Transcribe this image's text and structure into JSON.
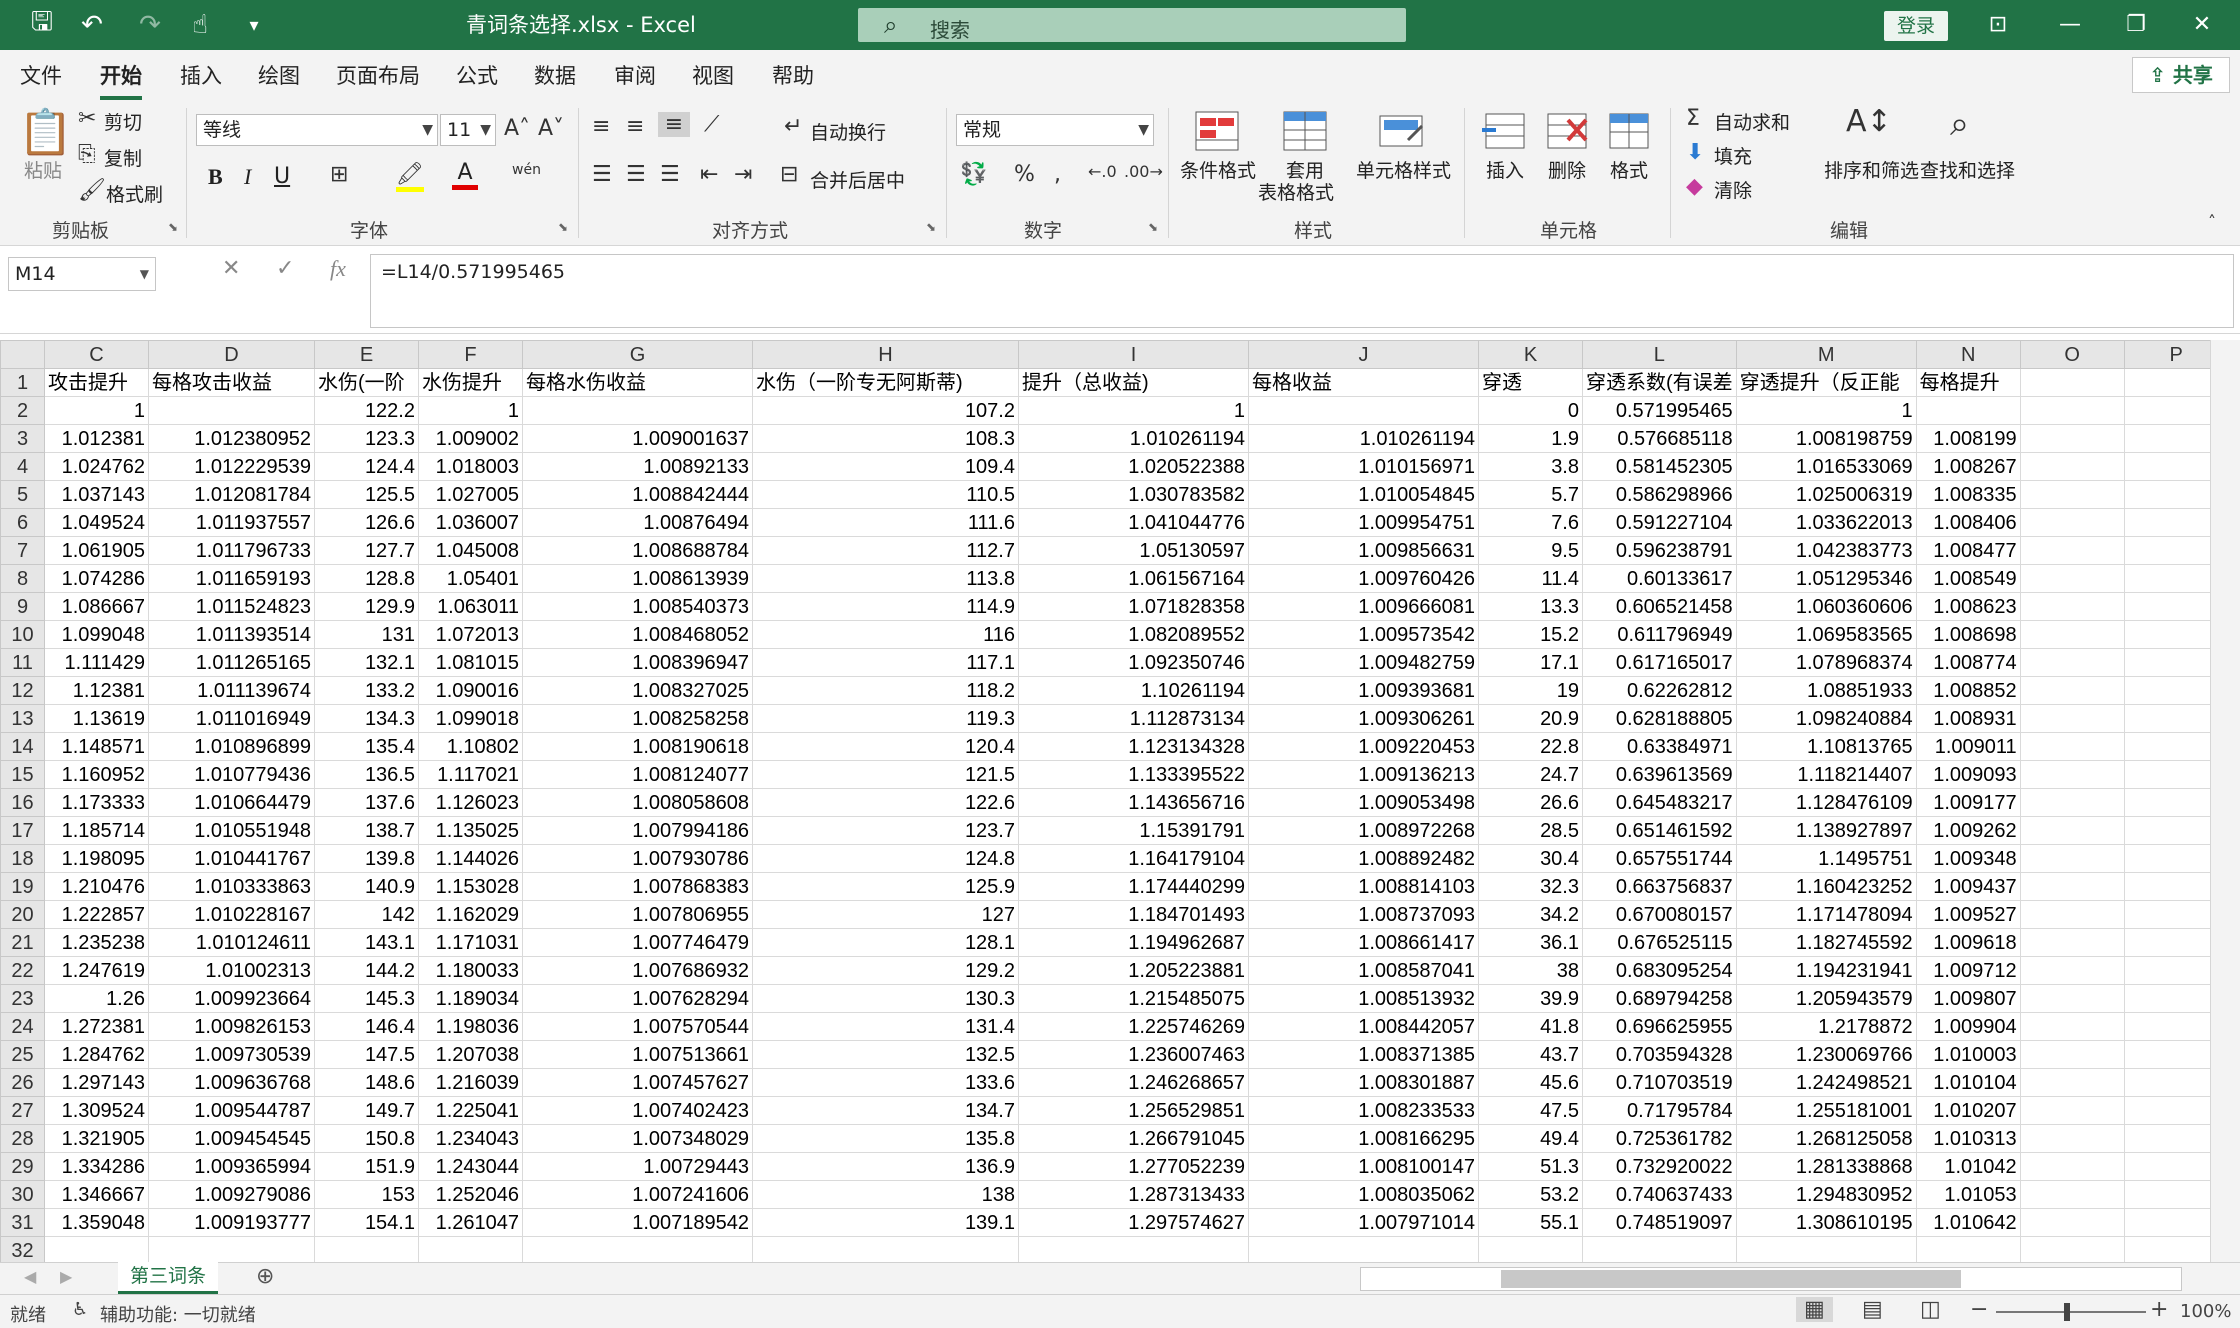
{
  "window": {
    "doc_title": "青词条选择.xlsx  -  Excel",
    "search_placeholder": "搜索",
    "login_label": "登录"
  },
  "menu": {
    "tabs": [
      "文件",
      "开始",
      "插入",
      "绘图",
      "页面布局",
      "公式",
      "数据",
      "审阅",
      "视图",
      "帮助"
    ],
    "active_tab": "开始",
    "share_label": "共享"
  },
  "ribbon": {
    "clipboard": {
      "label": "剪贴板",
      "paste": "粘贴",
      "cut": "剪切",
      "copy": "复制",
      "format_painter": "格式刷"
    },
    "font": {
      "label": "字体",
      "font_name": "等线",
      "font_size": "11",
      "bold": "B",
      "italic": "I",
      "underline": "U"
    },
    "alignment": {
      "label": "对齐方式",
      "wrap_text": "自动换行",
      "merge_center": "合并后居中"
    },
    "number": {
      "label": "数字",
      "format": "常规"
    },
    "styles": {
      "label": "样式",
      "conditional": "条件格式",
      "table_fmt_1": "套用",
      "table_fmt_2": "表格格式",
      "cell_styles": "单元格样式"
    },
    "cells": {
      "label": "单元格",
      "insert": "插入",
      "delete": "删除",
      "format": "格式"
    },
    "editing": {
      "label": "编辑",
      "autosum": "自动求和",
      "fill": "填充",
      "clear": "清除",
      "sort_filter": "排序和筛选",
      "find_select": "查找和选择"
    }
  },
  "formula_bar": {
    "name_box": "M14",
    "formula": "=L14/0.571995465",
    "fx": "fx"
  },
  "sheet": {
    "selected_column": "",
    "columns": [
      "C",
      "D",
      "E",
      "F",
      "G",
      "H",
      "I",
      "J",
      "K",
      "L",
      "M",
      "N",
      "O",
      "P"
    ],
    "header_row": [
      "攻击提升",
      "每格攻击收益",
      "水伤(一阶",
      "水伤提升",
      "每格水伤收益",
      "水伤（一阶专无阿斯蒂)",
      "提升（总收益)",
      "每格收益",
      "穿透",
      "穿透系数(有误差",
      "穿透提升（反正能",
      "每格提升",
      "",
      ""
    ],
    "rows": [
      [
        "1",
        "",
        "122.2",
        "1",
        "",
        "107.2",
        "1",
        "",
        "0",
        "0.571995465",
        "1",
        "",
        "",
        ""
      ],
      [
        "1.012381",
        "1.012380952",
        "123.3",
        "1.009002",
        "1.009001637",
        "108.3",
        "1.010261194",
        "1.010261194",
        "1.9",
        "0.576685118",
        "1.008198759",
        "1.008199",
        "",
        ""
      ],
      [
        "1.024762",
        "1.012229539",
        "124.4",
        "1.018003",
        "1.00892133",
        "109.4",
        "1.020522388",
        "1.010156971",
        "3.8",
        "0.581452305",
        "1.016533069",
        "1.008267",
        "",
        ""
      ],
      [
        "1.037143",
        "1.012081784",
        "125.5",
        "1.027005",
        "1.008842444",
        "110.5",
        "1.030783582",
        "1.010054845",
        "5.7",
        "0.586298966",
        "1.025006319",
        "1.008335",
        "",
        ""
      ],
      [
        "1.049524",
        "1.011937557",
        "126.6",
        "1.036007",
        "1.00876494",
        "111.6",
        "1.041044776",
        "1.009954751",
        "7.6",
        "0.591227104",
        "1.033622013",
        "1.008406",
        "",
        ""
      ],
      [
        "1.061905",
        "1.011796733",
        "127.7",
        "1.045008",
        "1.008688784",
        "112.7",
        "1.05130597",
        "1.009856631",
        "9.5",
        "0.596238791",
        "1.042383773",
        "1.008477",
        "",
        ""
      ],
      [
        "1.074286",
        "1.011659193",
        "128.8",
        "1.05401",
        "1.008613939",
        "113.8",
        "1.061567164",
        "1.009760426",
        "11.4",
        "0.60133617",
        "1.051295346",
        "1.008549",
        "",
        ""
      ],
      [
        "1.086667",
        "1.011524823",
        "129.9",
        "1.063011",
        "1.008540373",
        "114.9",
        "1.071828358",
        "1.009666081",
        "13.3",
        "0.606521458",
        "1.060360606",
        "1.008623",
        "",
        ""
      ],
      [
        "1.099048",
        "1.011393514",
        "131",
        "1.072013",
        "1.008468052",
        "116",
        "1.082089552",
        "1.009573542",
        "15.2",
        "0.611796949",
        "1.069583565",
        "1.008698",
        "",
        ""
      ],
      [
        "1.111429",
        "1.011265165",
        "132.1",
        "1.081015",
        "1.008396947",
        "117.1",
        "1.092350746",
        "1.009482759",
        "17.1",
        "0.617165017",
        "1.078968374",
        "1.008774",
        "",
        ""
      ],
      [
        "1.12381",
        "1.011139674",
        "133.2",
        "1.090016",
        "1.008327025",
        "118.2",
        "1.10261194",
        "1.009393681",
        "19",
        "0.62262812",
        "1.08851933",
        "1.008852",
        "",
        ""
      ],
      [
        "1.13619",
        "1.011016949",
        "134.3",
        "1.099018",
        "1.008258258",
        "119.3",
        "1.112873134",
        "1.009306261",
        "20.9",
        "0.628188805",
        "1.098240884",
        "1.008931",
        "",
        ""
      ],
      [
        "1.148571",
        "1.010896899",
        "135.4",
        "1.10802",
        "1.008190618",
        "120.4",
        "1.123134328",
        "1.009220453",
        "22.8",
        "0.63384971",
        "1.10813765",
        "1.009011",
        "",
        ""
      ],
      [
        "1.160952",
        "1.010779436",
        "136.5",
        "1.117021",
        "1.008124077",
        "121.5",
        "1.133395522",
        "1.009136213",
        "24.7",
        "0.639613569",
        "1.118214407",
        "1.009093",
        "",
        ""
      ],
      [
        "1.173333",
        "1.010664479",
        "137.6",
        "1.126023",
        "1.008058608",
        "122.6",
        "1.143656716",
        "1.009053498",
        "26.6",
        "0.645483217",
        "1.128476109",
        "1.009177",
        "",
        ""
      ],
      [
        "1.185714",
        "1.010551948",
        "138.7",
        "1.135025",
        "1.007994186",
        "123.7",
        "1.15391791",
        "1.008972268",
        "28.5",
        "0.651461592",
        "1.138927897",
        "1.009262",
        "",
        ""
      ],
      [
        "1.198095",
        "1.010441767",
        "139.8",
        "1.144026",
        "1.007930786",
        "124.8",
        "1.164179104",
        "1.008892482",
        "30.4",
        "0.657551744",
        "1.1495751",
        "1.009348",
        "",
        ""
      ],
      [
        "1.210476",
        "1.010333863",
        "140.9",
        "1.153028",
        "1.007868383",
        "125.9",
        "1.174440299",
        "1.008814103",
        "32.3",
        "0.663756837",
        "1.160423252",
        "1.009437",
        "",
        ""
      ],
      [
        "1.222857",
        "1.010228167",
        "142",
        "1.162029",
        "1.007806955",
        "127",
        "1.184701493",
        "1.008737093",
        "34.2",
        "0.670080157",
        "1.171478094",
        "1.009527",
        "",
        ""
      ],
      [
        "1.235238",
        "1.010124611",
        "143.1",
        "1.171031",
        "1.007746479",
        "128.1",
        "1.194962687",
        "1.008661417",
        "36.1",
        "0.676525115",
        "1.182745592",
        "1.009618",
        "",
        ""
      ],
      [
        "1.247619",
        "1.01002313",
        "144.2",
        "1.180033",
        "1.007686932",
        "129.2",
        "1.205223881",
        "1.008587041",
        "38",
        "0.683095254",
        "1.194231941",
        "1.009712",
        "",
        ""
      ],
      [
        "1.26",
        "1.009923664",
        "145.3",
        "1.189034",
        "1.007628294",
        "130.3",
        "1.215485075",
        "1.008513932",
        "39.9",
        "0.689794258",
        "1.205943579",
        "1.009807",
        "",
        ""
      ],
      [
        "1.272381",
        "1.009826153",
        "146.4",
        "1.198036",
        "1.007570544",
        "131.4",
        "1.225746269",
        "1.008442057",
        "41.8",
        "0.696625955",
        "1.2178872",
        "1.009904",
        "",
        ""
      ],
      [
        "1.284762",
        "1.009730539",
        "147.5",
        "1.207038",
        "1.007513661",
        "132.5",
        "1.236007463",
        "1.008371385",
        "43.7",
        "0.703594328",
        "1.230069766",
        "1.010003",
        "",
        ""
      ],
      [
        "1.297143",
        "1.009636768",
        "148.6",
        "1.216039",
        "1.007457627",
        "133.6",
        "1.246268657",
        "1.008301887",
        "45.6",
        "0.710703519",
        "1.242498521",
        "1.010104",
        "",
        ""
      ],
      [
        "1.309524",
        "1.009544787",
        "149.7",
        "1.225041",
        "1.007402423",
        "134.7",
        "1.256529851",
        "1.008233533",
        "47.5",
        "0.71795784",
        "1.255181001",
        "1.010207",
        "",
        ""
      ],
      [
        "1.321905",
        "1.009454545",
        "150.8",
        "1.234043",
        "1.007348029",
        "135.8",
        "1.266791045",
        "1.008166295",
        "49.4",
        "0.725361782",
        "1.268125058",
        "1.010313",
        "",
        ""
      ],
      [
        "1.334286",
        "1.009365994",
        "151.9",
        "1.243044",
        "1.00729443",
        "136.9",
        "1.277052239",
        "1.008100147",
        "51.3",
        "0.732920022",
        "1.281338868",
        "1.01042",
        "",
        ""
      ],
      [
        "1.346667",
        "1.009279086",
        "153",
        "1.252046",
        "1.007241606",
        "138",
        "1.287313433",
        "1.008035062",
        "53.2",
        "0.740637433",
        "1.294830952",
        "1.01053",
        "",
        ""
      ],
      [
        "1.359048",
        "1.009193777",
        "154.1",
        "1.261047",
        "1.007189542",
        "139.1",
        "1.297574627",
        "1.007971014",
        "55.1",
        "0.748519097",
        "1.308610195",
        "1.010642",
        "",
        ""
      ]
    ],
    "last_row_number": "32",
    "tab_name": "第三词条"
  },
  "status": {
    "ready": "就绪",
    "accessibility": "辅助功能: 一切就绪",
    "zoom": "100%"
  },
  "colors": {
    "accent": "#217346"
  }
}
